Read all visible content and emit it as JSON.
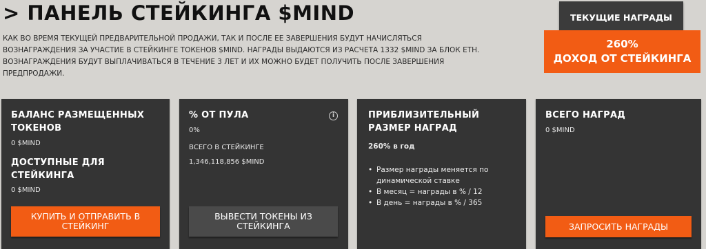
{
  "header": {
    "title": "> ПАНЕЛЬ СТЕЙКИНГА $MIND",
    "description": "КАК ВО ВРЕМЯ ТЕКУЩЕЙ ПРЕДВАРИТЕЛЬНОЙ ПРОДАЖИ, ТАК И ПОСЛЕ ЕЕ ЗАВЕРШЕНИЯ БУДУТ НАЧИСЛЯТЬСЯ ВОЗНАГРАЖДЕНИЯ ЗА УЧАСТИЕ В СТЕЙКИНГЕ ТОКЕНОВ $MIND. НАГРАДЫ ВЫДАЮТСЯ ИЗ РАСЧЕТА 1332 $MIND ЗА БЛОК ETH. ВОЗНАГРАЖДЕНИЯ БУДУТ ВЫПЛАЧИВАТЬСЯ В ТЕЧЕНИЕ 3 ЛЕТ И ИХ МОЖНО БУДЕТ ПОЛУЧИТЬ ПОСЛЕ ЗАВЕРШЕНИЯ ПРЕДПРОДАЖИ."
  },
  "rewards": {
    "tab_label": "ТЕКУЩИЕ НАГРАДЫ",
    "percent": "260%",
    "label": "ДОХОД ОТ СТЕЙКИНГА"
  },
  "card_balance": {
    "staked_heading": "БАЛАНС РАЗМЕЩЕННЫХ ТОКЕНОВ",
    "staked_value": "0  $MIND",
    "available_heading": "ДОСТУПНЫЕ ДЛЯ СТЕЙКИНГА",
    "available_value": "0  $MIND",
    "button": "КУПИТЬ И ОТПРАВИТЬ В СТЕЙКИНГ"
  },
  "card_pool": {
    "heading": "% ОТ ПУЛА",
    "value": "0%",
    "total_label": "ВСЕГО В СТЕЙКИНГЕ",
    "total_value": "1,346,118,856  $MIND",
    "button": "ВЫВЕСТИ ТОКЕНЫ ИЗ СТЕЙКИНГА",
    "info_icon": "i"
  },
  "card_estimate": {
    "heading": "ПРИБЛИЗИТЕЛЬНЫЙ РАЗМЕР НАГРАД",
    "rate": "260% в год",
    "bullets": [
      "Размер награды меняется по динамической ставке",
      "В месяц = награды в % / 12",
      "В день = награды в % / 365"
    ]
  },
  "card_total": {
    "heading": "ВСЕГО НАГРАД",
    "value": "0  $MIND",
    "button": "ЗАПРОСИТЬ НАГРАДЫ"
  },
  "colors": {
    "accent": "#f25c14",
    "card_bg": "#343434",
    "page_bg": "#d6d4d0"
  }
}
